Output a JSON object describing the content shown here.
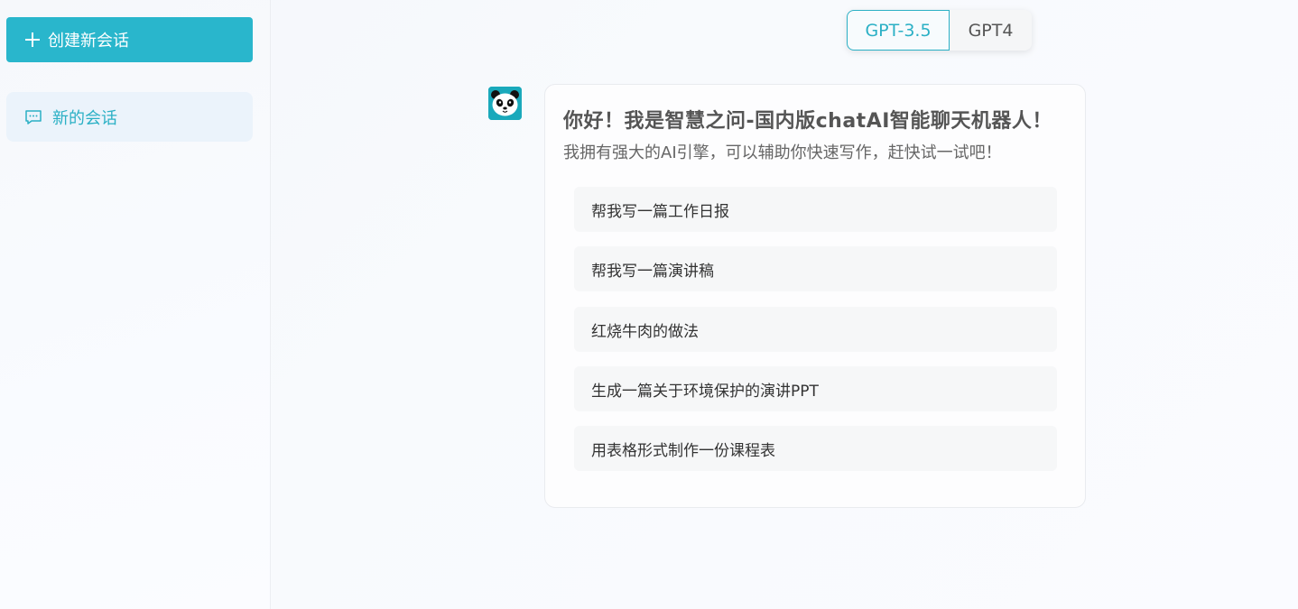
{
  "sidebar": {
    "new_chat_label": "创建新会话",
    "conversations": [
      {
        "label": "新的会话"
      }
    ]
  },
  "model_switch": {
    "options": [
      {
        "label": "GPT-3.5",
        "active": true
      },
      {
        "label": "GPT4",
        "active": false
      }
    ]
  },
  "welcome": {
    "title": "你好！我是智慧之问-国内版chatAI智能聊天机器人！",
    "subtitle": "我拥有强大的AI引擎，可以辅助你快速写作，赶快试一试吧！",
    "suggestions": [
      "帮我写一篇工作日报",
      "帮我写一篇演讲稿",
      "红烧牛肉的做法",
      "生成一篇关于环境保护的演讲PPT",
      "用表格形式制作一份课程表"
    ]
  },
  "colors": {
    "accent": "#29b6cc",
    "sidebar_active_bg": "#ebf3fb",
    "card_bg": "#fdfdfe",
    "suggestion_bg": "#f6f7f8"
  },
  "icons": {
    "new_chat": "plus-icon",
    "conversation": "chat-bubble-icon",
    "avatar": "panda-avatar"
  }
}
